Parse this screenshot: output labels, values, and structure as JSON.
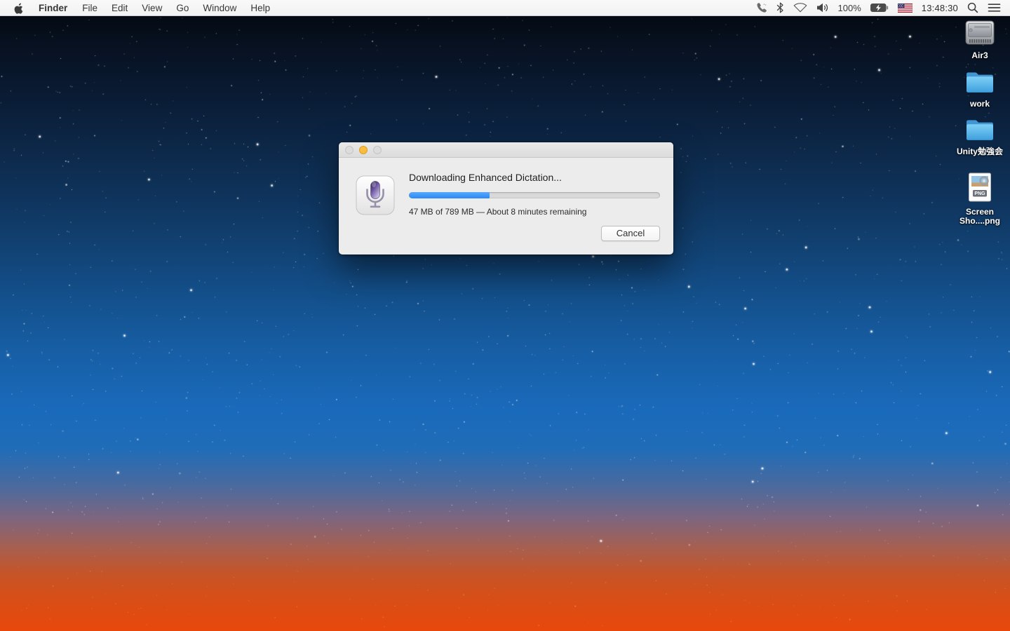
{
  "menu_bar": {
    "app_name": "Finder",
    "menus": [
      "File",
      "Edit",
      "View",
      "Go",
      "Window",
      "Help"
    ],
    "status": {
      "battery_percent": "100%",
      "clock": "13:48:30"
    }
  },
  "dialog": {
    "title": "Downloading Enhanced Dictation...",
    "progress_percent": 32,
    "status_text": "47 MB of 789 MB — About 8 minutes remaining",
    "cancel_label": "Cancel"
  },
  "desktop_icons": [
    {
      "label": "Air3",
      "type": "hard-drive"
    },
    {
      "label": "work",
      "type": "folder"
    },
    {
      "label": "Unity勉強会",
      "type": "folder"
    },
    {
      "label": "Screen Sho....png",
      "type": "png-image-file",
      "badge": "PNG"
    }
  ],
  "colors": {
    "progress_fill": "#2c88f5",
    "minimize_button": "#f8bd40",
    "folder_blue": "#55b0e8",
    "sky_top": "#03060c",
    "sky_blue": "#1a6abb",
    "horizon_orange": "#e8480c"
  }
}
